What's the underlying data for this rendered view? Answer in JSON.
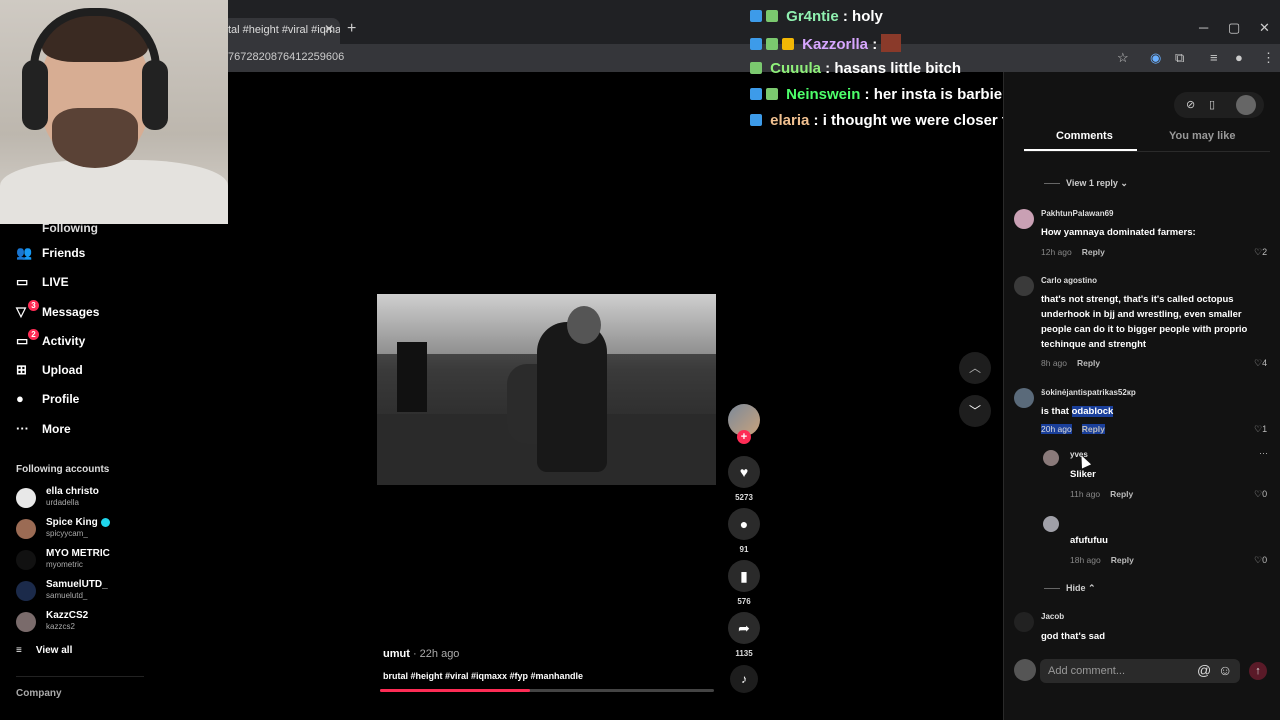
{
  "browser": {
    "tab_title": "tal #height #viral #iqmax",
    "tab_close": "✕",
    "new_tab": "+",
    "url": "7672820876412259606",
    "minimize": "─",
    "maximize": "▢",
    "close": "✕",
    "star": "☆"
  },
  "sidebar": {
    "following_partial": "Following",
    "items": [
      {
        "label": "Friends",
        "icon": "friends-icon",
        "glyph": "👥"
      },
      {
        "label": "LIVE",
        "icon": "live-icon",
        "glyph": "▭"
      },
      {
        "label": "Messages",
        "icon": "messages-icon",
        "glyph": "▽",
        "badge": "3"
      },
      {
        "label": "Activity",
        "icon": "activity-icon",
        "glyph": "▭",
        "badge": "2"
      },
      {
        "label": "Upload",
        "icon": "upload-icon",
        "glyph": "⊞"
      },
      {
        "label": "Profile",
        "icon": "profile-icon",
        "glyph": "●"
      },
      {
        "label": "More",
        "icon": "more-icon",
        "glyph": "···"
      }
    ],
    "following_title": "Following accounts",
    "accounts": [
      {
        "name": "ella christo",
        "user": "urdadella",
        "color": "#e8e8e8",
        "verified": false
      },
      {
        "name": "Spice King",
        "user": "spicyycam_",
        "color": "#9b6b54",
        "verified": true
      },
      {
        "name": "MYO METRIC",
        "user": "myometric",
        "color": "#111111",
        "verified": false
      },
      {
        "name": "SamuelUTD_",
        "user": "samuelutd_",
        "color": "#1b2a4a",
        "verified": false
      },
      {
        "name": "KazzCS2",
        "user": "kazzcs2",
        "color": "#7a6b6b",
        "verified": false
      }
    ],
    "view_all": "View all",
    "view_all_glyph": "≡",
    "company": "Company"
  },
  "chat": [
    {
      "name": "Gr4ntie",
      "name_color": "#8ff0b0",
      "message": "holy",
      "badges": [
        "#3d9be9",
        "#7bc96f"
      ]
    },
    {
      "name": "Kazzorlla",
      "name_color": "#d7a6ff",
      "message": "",
      "badges": [
        "#3d9be9",
        "#7bc96f",
        "#f2b705"
      ],
      "emote": true
    },
    {
      "name": "Cuuula",
      "name_color": "#8ff07a",
      "message": "hasans little bitch",
      "badges": [
        "#7bc96f"
      ]
    },
    {
      "name": "Neinswein",
      "name_color": "#4dff6a",
      "message": "her insta is barbie?",
      "badges": [
        "#3d9be9",
        "#7bc96f"
      ]
    },
    {
      "name": "elaria",
      "name_color": "#f0c090",
      "message": "i thought we were closer than that",
      "badges": [
        "#3d9be9"
      ]
    }
  ],
  "video": {
    "author": "umut",
    "time": " · 22h ago",
    "caption": "brutal #height #viral #iqmaxx #fyp #manhandle",
    "progress": 0.45
  },
  "actions": {
    "follow_plus": "+",
    "likes": "5273",
    "comments": "91",
    "saves": "576",
    "shares": "1135",
    "like_glyph": "♥",
    "comment_glyph": "●",
    "save_glyph": "▮",
    "share_glyph": "➦",
    "sound_glyph": "♪",
    "up_glyph": "︿",
    "down_glyph": "﹀"
  },
  "panel": {
    "tabs": [
      "Comments",
      "You may like"
    ],
    "view_reply": "View 1 reply",
    "hide": "Hide",
    "comments": [
      {
        "user": "PakhtunPalawan69",
        "text": "How yamnaya dominated farmers:",
        "time": "12h ago",
        "reply": "Reply",
        "likes": "2",
        "color": "#c9a0b4"
      },
      {
        "user": "Carlo agostino",
        "text": "that's not strengt, that's it's called octopus underhook in bjj and wrestling, even smaller people can do it to bigger people with proprio techinque and strenght",
        "time": "8h ago",
        "reply": "Reply",
        "likes": "4",
        "color": "#3a3a3a"
      },
      {
        "user": "šokinėjantispatrikas52кр",
        "text_prefix": "is that ",
        "text_highlight": "odablock",
        "time": "20h ago",
        "reply": "Reply",
        "likes": "1",
        "color": "#5a6a7a"
      }
    ],
    "replies": [
      {
        "user": "yves",
        "text": "Sliker",
        "time": "11h ago",
        "reply": "Reply",
        "likes": "0",
        "more": "···",
        "color": "#8a7a7a"
      },
      {
        "user": "",
        "text": "afufufuu",
        "time": "18h ago",
        "reply": "Reply",
        "likes": "0",
        "color": "#a0a0a8"
      }
    ],
    "last_comment": {
      "user": "Jacob",
      "text": "god that's sad",
      "color": "#222222"
    },
    "add_comment_placeholder": "Add comment...",
    "at_glyph": "@",
    "emoji_glyph": "☺",
    "post_glyph": "↑"
  }
}
